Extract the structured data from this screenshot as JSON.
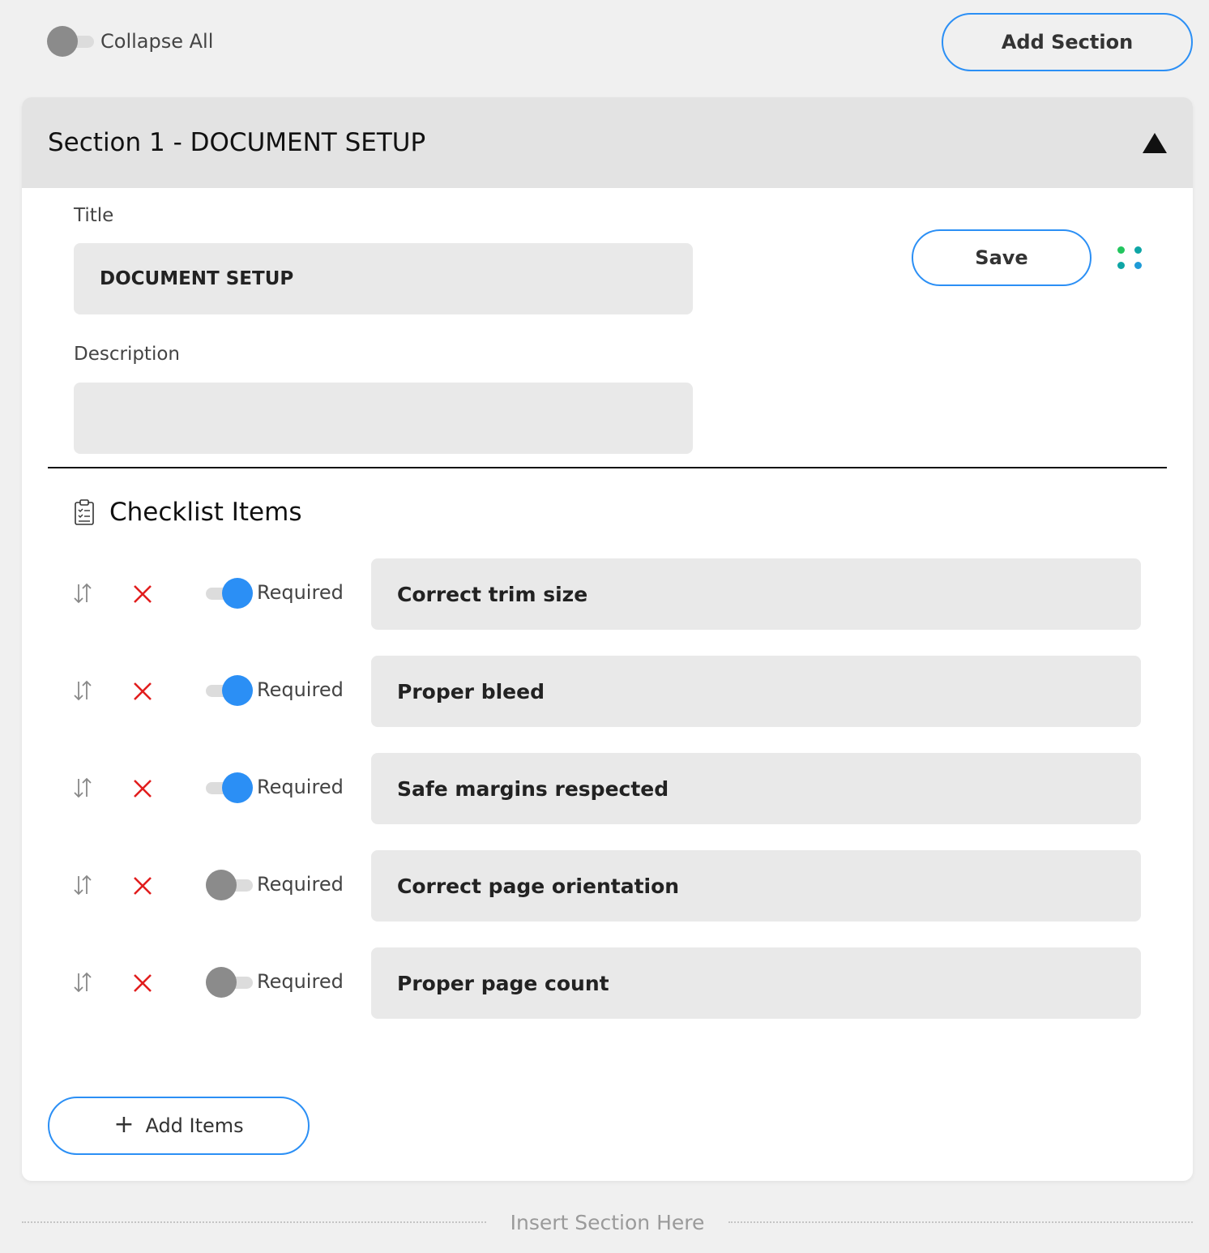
{
  "top_bar": {
    "collapse_all_label": "Collapse All",
    "collapse_all_on": false,
    "add_section_label": "Add Section"
  },
  "section": {
    "header_title": "Section 1 - DOCUMENT SETUP",
    "title_label": "Title",
    "title_value": "DOCUMENT SETUP",
    "description_label": "Description",
    "description_value": "",
    "save_label": "Save",
    "checklist_heading": "Checklist Items",
    "items": [
      {
        "text": "Correct trim size",
        "required_label": "Required",
        "required": true
      },
      {
        "text": "Proper bleed",
        "required_label": "Required",
        "required": true
      },
      {
        "text": "Safe margins respected",
        "required_label": "Required",
        "required": true
      },
      {
        "text": "Correct page orientation",
        "required_label": "Required",
        "required": false
      },
      {
        "text": "Proper page count",
        "required_label": "Required",
        "required": false
      }
    ],
    "add_items_label": "Add Items"
  },
  "insert_section_label": "Insert Section Here",
  "colors": {
    "accent": "#2b8ff5",
    "toggle_off": "#8b8b8b",
    "delete": "#e11d1d",
    "dot_green": "#22c55e",
    "dot_teal": "#0ea5a5",
    "dot_blue": "#1e9bd7"
  }
}
